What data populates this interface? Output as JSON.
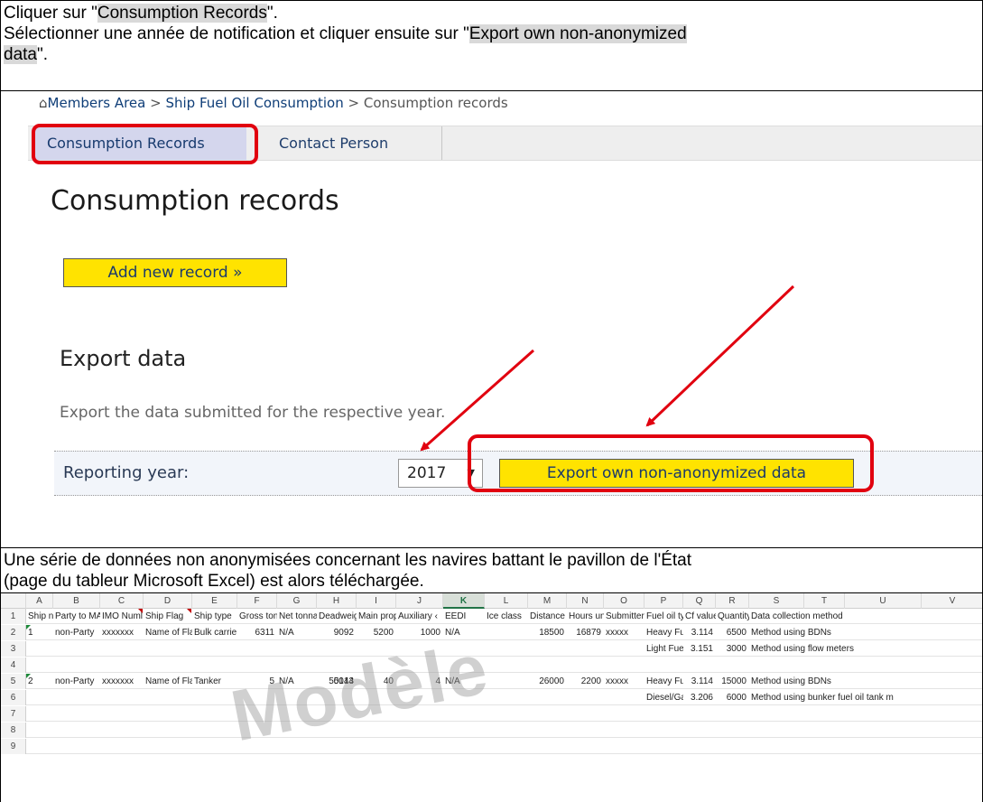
{
  "instructions": {
    "step1_prefix": "Cliquer sur \"",
    "step1_link": "Consumption Records",
    "step1_suffix": "\".",
    "step2_prefix": "Sélectionner une année de notification et cliquer ensuite sur \"",
    "step2_link_a": "Export own non-anonymized",
    "step2_link_b": "data",
    "step2_suffix": "\".",
    "step3_line1": "Une série de données non anonymisées concernant les navires battant le pavillon de l'État",
    "step3_line2": "(page du tableur Microsoft Excel) est alors téléchargée."
  },
  "site": {
    "breadcrumb": {
      "home_icon": "home-icon",
      "items": [
        "Members Area",
        "Ship Fuel Oil Consumption",
        "Consumption records"
      ],
      "separator": ">"
    },
    "tabs": [
      {
        "label": "Consumption Records",
        "active": true
      },
      {
        "label": "Contact Person",
        "active": false
      }
    ],
    "page_title": "Consumption records",
    "add_button": "Add new record »",
    "export": {
      "title": "Export data",
      "description": "Export the data submitted for the respective year.",
      "reporting_year_label": "Reporting year:",
      "selected_year": "2017",
      "caret": "▼",
      "export_button": "Export own non-anonymized data"
    },
    "colors": {
      "highlight_red": "#e1000f",
      "button_yellow": "#ffe300",
      "active_tab": "#d4d6ed"
    }
  },
  "excel": {
    "watermark": "Modèle",
    "columns": [
      "A",
      "B",
      "C",
      "D",
      "E",
      "F",
      "G",
      "H",
      "I",
      "J",
      "K",
      "L",
      "M",
      "N",
      "O",
      "P",
      "Q",
      "R",
      "S",
      "T",
      "U",
      "V"
    ],
    "selected_column": "K",
    "row_numbers": [
      "1",
      "2",
      "3",
      "4",
      "5",
      "6",
      "7",
      "8",
      "9"
    ],
    "header_row": [
      "Ship no.",
      "Party to MAF",
      "IMO Numl",
      "Ship Flag",
      "Ship type",
      "Gross tonr",
      "Net tonna",
      "Deadweig",
      "Main prop",
      "Auxiliary ‹",
      "EEDI",
      "Ice class",
      "Distance t",
      "Hours und",
      "Submitter",
      "Fuel oil type",
      "Cf value",
      "Quantity",
      "Data collection method"
    ],
    "row2": [
      "1",
      "non-Party",
      "xxxxxxx",
      "Name of Flag",
      "Bulk carrie",
      "6311",
      "N/A",
      "9092",
      "5200",
      "1000",
      "N/A",
      "",
      "18500",
      "16879",
      "xxxxx",
      "Heavy Fuel (",
      "3.114",
      "6500",
      "Method using BDNs"
    ],
    "row3": {
      "fuel": "Light Fuel O",
      "cf": "3.151",
      "qty": "3000",
      "method": "Method using flow meters"
    },
    "row5": [
      "2",
      "non-Party",
      "xxxxxxx",
      "Name of Flag",
      "Tanker",
      "",
      "N/A",
      "5014",
      "40",
      "",
      "N/A",
      "",
      "26000",
      "2200",
      "xxxxx",
      "Heavy Fuel (",
      "3.114",
      "15000",
      "Method using BDNs"
    ],
    "row5_partial": {
      "gross": "5",
      "dead": "50143",
      "aux": "4"
    },
    "row6": {
      "fuel": "Diesel/Gas (",
      "cf": "3.206",
      "qty": "6000",
      "method": "Method using bunker fuel oil tank m"
    }
  }
}
